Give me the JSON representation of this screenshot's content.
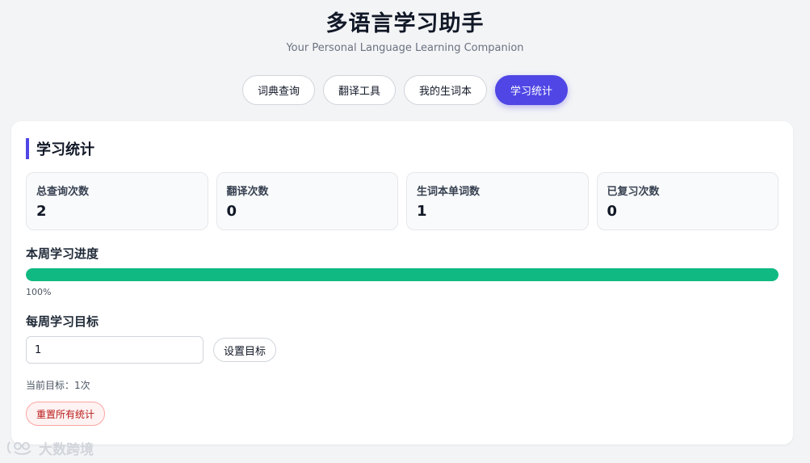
{
  "header": {
    "title": "多语言学习助手",
    "subtitle": "Your Personal Language Learning Companion"
  },
  "tabs": [
    {
      "label": "词典查询",
      "active": false
    },
    {
      "label": "翻译工具",
      "active": false
    },
    {
      "label": "我的生词本",
      "active": false
    },
    {
      "label": "学习统计",
      "active": true
    }
  ],
  "stats_section": {
    "title": "学习统计",
    "cards": [
      {
        "label": "总查询次数",
        "value": "2"
      },
      {
        "label": "翻译次数",
        "value": "0"
      },
      {
        "label": "生词本单词数",
        "value": "1"
      },
      {
        "label": "已复习次数",
        "value": "0"
      }
    ]
  },
  "weekly_progress": {
    "heading": "本周学习进度",
    "percent": 100,
    "percent_label": "100%",
    "color": "#10b981"
  },
  "weekly_goal": {
    "heading": "每周学习目标",
    "input_value": "1",
    "set_button": "设置目标",
    "current_goal_text": "当前目标：1次"
  },
  "reset_button": "重置所有统计",
  "watermark": "大数跨境",
  "colors": {
    "accent": "#4f46e5",
    "progress": "#10b981",
    "danger": "#b91c1c"
  }
}
